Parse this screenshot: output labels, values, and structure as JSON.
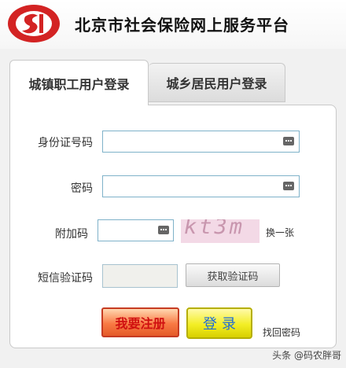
{
  "header": {
    "site_title": "北京市社会保险网上服务平台",
    "logo_colors": {
      "red": "#d32323"
    }
  },
  "tabs": [
    {
      "label": "城镇职工用户登录",
      "active": true
    },
    {
      "label": "城乡居民用户登录",
      "active": false
    }
  ],
  "form": {
    "id_label": "身份证号码",
    "id_value": "",
    "password_label": "密码",
    "password_value": "",
    "captcha_label": "附加码",
    "captcha_value": "",
    "captcha_text": "kt3m",
    "refresh_captcha": "换一张",
    "sms_label": "短信验证码",
    "sms_value": "",
    "get_sms_button": "获取验证码",
    "register_button": "我要注册",
    "login_button": "登录",
    "forgot_password": "找回密码"
  },
  "icons": {
    "keyboard": "virtual-keyboard-icon"
  },
  "watermark": "头条 @码农胖哥"
}
